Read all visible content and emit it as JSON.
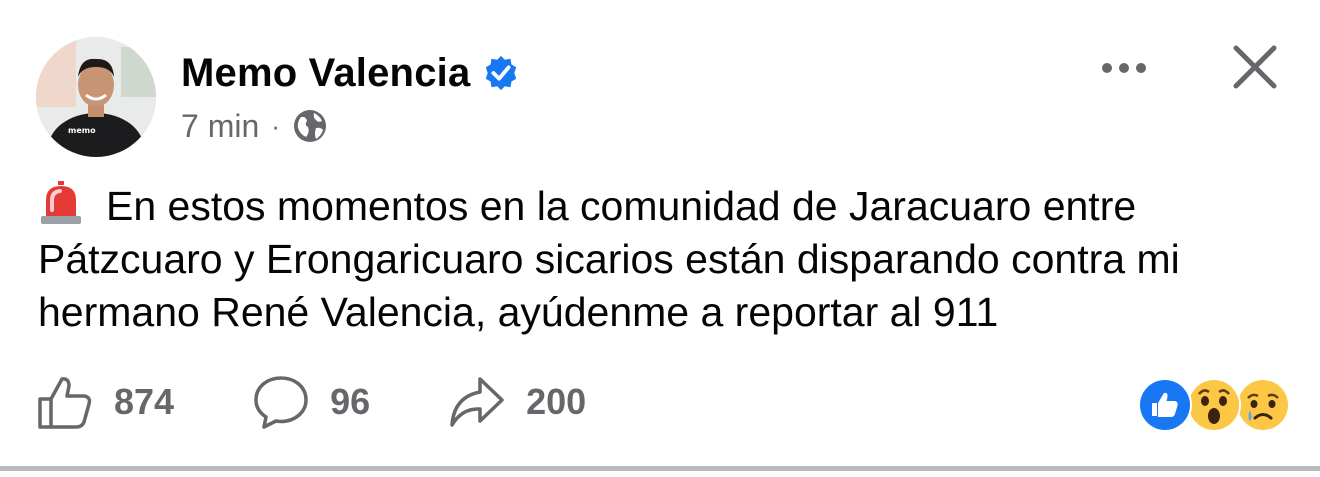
{
  "post": {
    "author": "Memo Valencia",
    "timestamp": "7 min",
    "separator": "·",
    "audience_icon": "globe-icon",
    "verified_icon": "verified-badge-icon",
    "emoji": "rotating-light-siren",
    "text": "En estos momentos en la comunidad de Jaracuaro entre Pátzcuaro y Erongaricuaro sicarios están disparando contra mi hermano René Valencia, ayúdenme a reportar al 911"
  },
  "actions": {
    "like_count": "874",
    "comment_count": "96",
    "share_count": "200"
  },
  "reactions": [
    "like",
    "wow",
    "sad"
  ],
  "colors": {
    "accent": "#1877f2",
    "secondary_text": "#65676b",
    "reaction_yellow": "#fcc744"
  }
}
